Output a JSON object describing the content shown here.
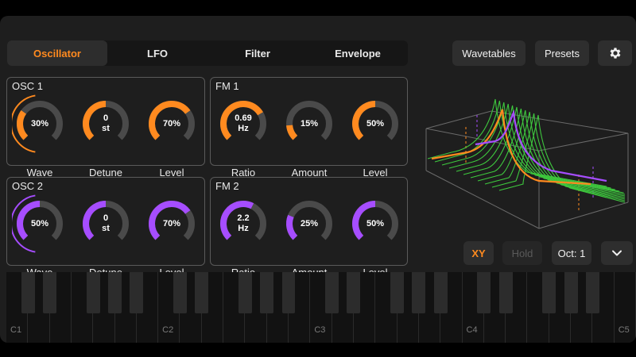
{
  "tabs": [
    {
      "label": "Oscillator",
      "active": true
    },
    {
      "label": "LFO",
      "active": false
    },
    {
      "label": "Filter",
      "active": false
    },
    {
      "label": "Envelope",
      "active": false
    }
  ],
  "toolbar": {
    "wavetables_label": "Wavetables",
    "presets_label": "Presets",
    "settings_icon": "gear-icon"
  },
  "colors": {
    "accent_orange": "#ff8a1f",
    "accent_purple": "#a64dff",
    "track": "#4a4a4a",
    "graph_green": "#3ec93e"
  },
  "panels": {
    "osc1": {
      "title": "OSC 1",
      "knobs": [
        {
          "value": "30%",
          "label": "Wave",
          "level": 0.3
        },
        {
          "value_line1": "0",
          "value_line2": "st",
          "label": "Detune",
          "level": 0.5
        },
        {
          "value": "70%",
          "label": "Level",
          "level": 0.7
        }
      ]
    },
    "fm1": {
      "title": "FM 1",
      "knobs": [
        {
          "value_line1": "0.69",
          "value_line2": "Hz",
          "label": "Ratio",
          "level": 0.72
        },
        {
          "value": "15%",
          "label": "Amount",
          "level": 0.15
        },
        {
          "value": "50%",
          "label": "Level",
          "level": 0.5
        }
      ]
    },
    "osc2": {
      "title": "OSC 2",
      "knobs": [
        {
          "value": "50%",
          "label": "Wave",
          "level": 0.5
        },
        {
          "value_line1": "0",
          "value_line2": "st",
          "label": "Detune",
          "level": 0.5
        },
        {
          "value": "70%",
          "label": "Level",
          "level": 0.7
        }
      ]
    },
    "fm2": {
      "title": "FM 2",
      "knobs": [
        {
          "value_line1": "2.2",
          "value_line2": "Hz",
          "label": "Ratio",
          "level": 0.6
        },
        {
          "value": "25%",
          "label": "Amount",
          "level": 0.25
        },
        {
          "value": "50%",
          "label": "Level",
          "level": 0.5
        }
      ]
    }
  },
  "controls": {
    "xy_label": "XY",
    "hold_label": "Hold",
    "octave_label": "Oct: 1",
    "expand_icon": "chevron-down-icon"
  },
  "keyboard": {
    "octave_labels": [
      "C1",
      "C2",
      "C3",
      "C4",
      "C5"
    ]
  }
}
